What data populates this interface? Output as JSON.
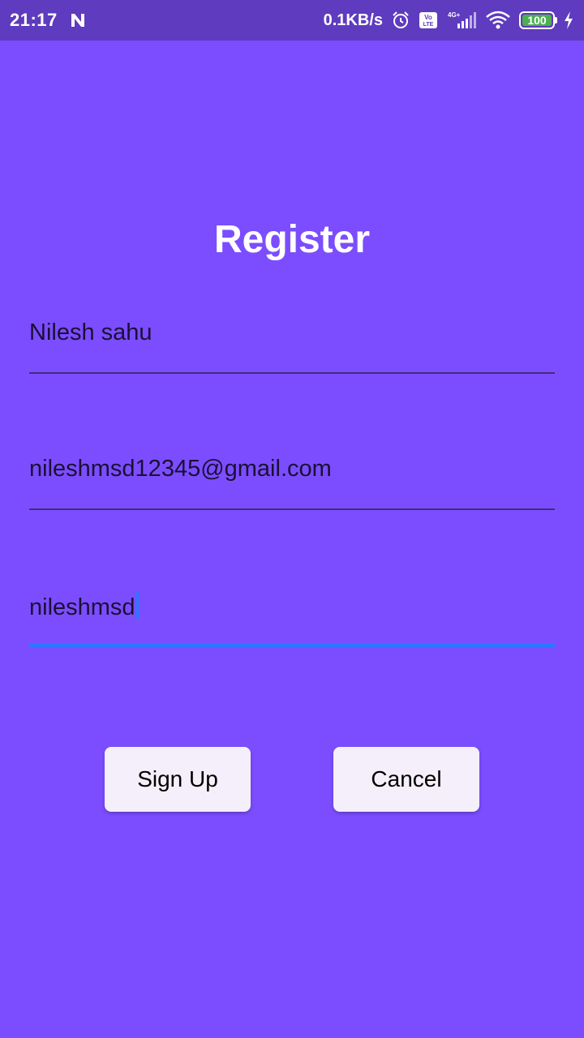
{
  "status_bar": {
    "time": "21:17",
    "network_speed": "0.1KB/s",
    "network_type": "4G+",
    "volte": "Vo LTE",
    "battery_level": "100",
    "icons": [
      "notification-n-icon",
      "alarm-icon",
      "volte-icon",
      "signal-icon",
      "wifi-icon",
      "battery-icon",
      "charging-icon"
    ]
  },
  "page": {
    "title": "Register"
  },
  "form": {
    "name_value": "Nilesh sahu",
    "email_value": "nileshmsd12345@gmail.com",
    "password_value": "nileshmsd"
  },
  "buttons": {
    "signup_label": "Sign Up",
    "cancel_label": "Cancel"
  },
  "colors": {
    "background": "#7c4dff",
    "status_bar": "#5e3bbf",
    "focus_accent": "#2979ff",
    "button_bg": "#f4effa"
  }
}
